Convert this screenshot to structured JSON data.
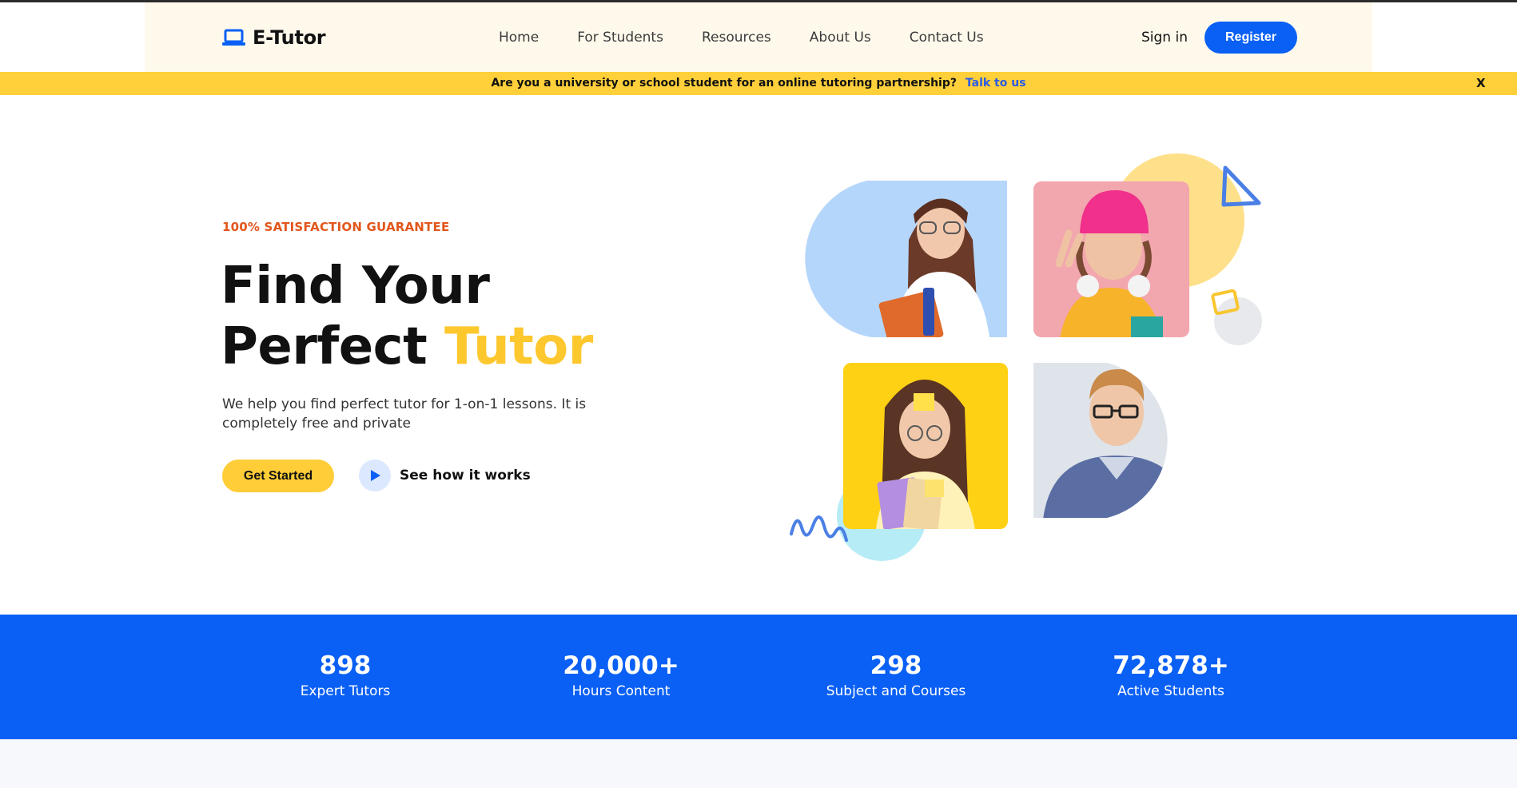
{
  "brand": {
    "name": "E-Tutor",
    "icon": "laptop-icon",
    "accent": "#0a60f5"
  },
  "nav": [
    {
      "label": "Home"
    },
    {
      "label": "For Students"
    },
    {
      "label": "Resources"
    },
    {
      "label": "About Us"
    },
    {
      "label": "Contact Us"
    }
  ],
  "auth": {
    "signin": "Sign in",
    "register": "Register"
  },
  "banner": {
    "text": "Are you a university or school student for an online tutoring partnership?",
    "link": "Talk to us",
    "close": "X",
    "color": "#ffd03a"
  },
  "hero": {
    "eyebrow": "100% SATISFACTION GUARANTEE",
    "title_line1": "Find Your",
    "title_line2_prefix": "Perfect ",
    "title_line2_accent": "Tutor",
    "subtitle": "We help you find perfect tutor for 1-on-1 lessons. It is completely free and private",
    "cta_primary": "Get Started",
    "cta_secondary": "See how it works",
    "cta_secondary_icon": "play-icon"
  },
  "stats": [
    {
      "value": "898",
      "label": "Expert Tutors"
    },
    {
      "value": "20,000+",
      "label": "Hours Content"
    },
    {
      "value": "298",
      "label": "Subject and Courses"
    },
    {
      "value": "72,878+",
      "label": "Active Students"
    }
  ]
}
